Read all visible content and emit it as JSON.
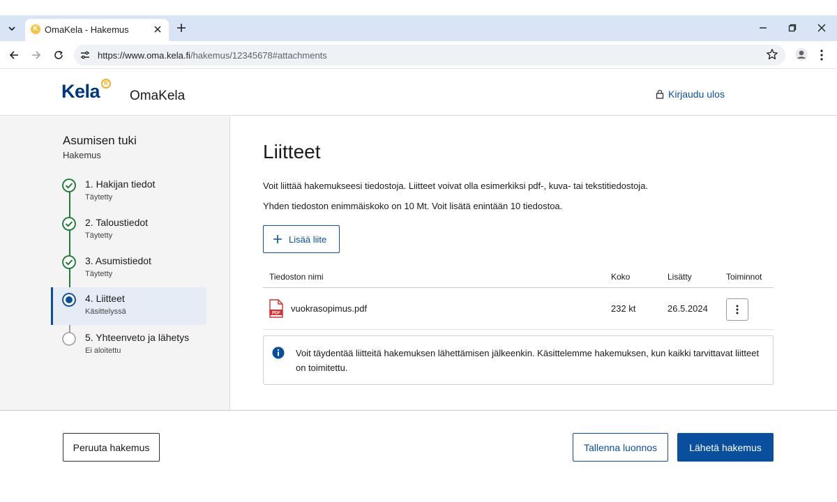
{
  "browser": {
    "tab_title": "OmaKela - Hakemus",
    "url_main": "https://www.oma.kela.fi",
    "url_path": "/hakemus/12345678#attachments"
  },
  "header": {
    "logo": "Kela",
    "service": "OmaKela",
    "logout": "Kirjaudu ulos"
  },
  "sidebar": {
    "title": "Asumisen tuki",
    "subtitle": "Hakemus",
    "steps": [
      {
        "label": "1. Hakijan tiedot",
        "status": "Täytetty",
        "state": "done"
      },
      {
        "label": "2. Taloustiedot",
        "status": "Täytetty",
        "state": "done"
      },
      {
        "label": "3. Asumistiedot",
        "status": "Täytetty",
        "state": "done"
      },
      {
        "label": "4. Liitteet",
        "status": "Käsittelyssä",
        "state": "active"
      },
      {
        "label": "5. Yhteenveto ja lähetys",
        "status": "Ei aloitettu",
        "state": "todo"
      }
    ]
  },
  "main": {
    "title": "Liitteet",
    "intro1": "Voit liittää hakemukseesi tiedostoja. Liitteet voivat olla esimerkiksi pdf-, kuva- tai tekstitiedostoja.",
    "intro2": "Yhden tiedoston enimmäiskoko on 10 Mt. Voit lisätä enintään 10 tiedostoa.",
    "add_button": "Lisää liite",
    "table": {
      "headers": {
        "name": "Tiedoston nimi",
        "size": "Koko",
        "added": "Lisätty",
        "actions": "Toiminnot"
      },
      "rows": [
        {
          "name": "vuokrasopimus.pdf",
          "size": "232 kt",
          "added": "26.5.2024",
          "icon": "pdf-icon"
        }
      ]
    },
    "info": "Voit täydentää liitteitä hakemuksen lähettämisen jälkeenkin. Käsittelemme hakemuksen, kun kaikki tarvittavat liitteet on toimitettu."
  },
  "footer": {
    "cancel": "Peruuta hakemus",
    "save": "Tallenna luonnos",
    "send": "Lähetä hakemus"
  },
  "colors": {
    "primary": "#0a4f9e",
    "success": "#1e7d32",
    "logo_accent": "#f0b323",
    "pdf_red": "#d32f2f"
  }
}
